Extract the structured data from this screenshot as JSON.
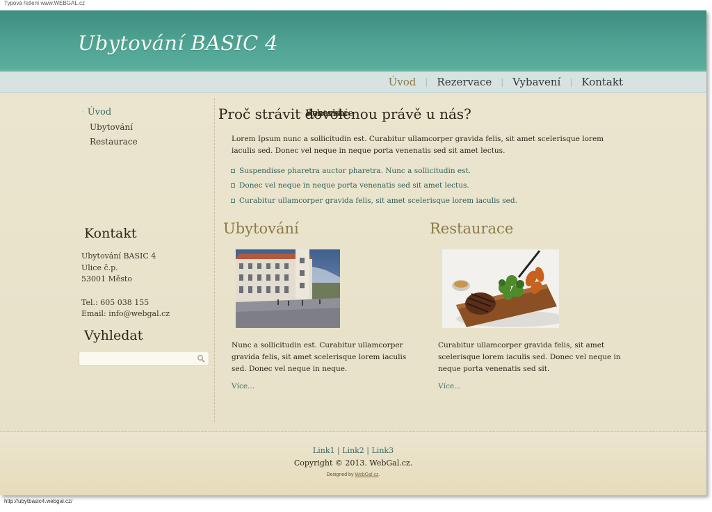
{
  "top_note": "Typová řešení www.WEBGAL.cz",
  "site_title": "Ubytování BASIC 4",
  "top_nav": {
    "items": [
      "Úvod",
      "Rezervace",
      "Vybavení",
      "Kontakt"
    ],
    "active": "Úvod"
  },
  "sidebar": {
    "menu": {
      "uvod": "Úvod",
      "ubytovani": "Ubytování",
      "restaurace": "Restaurace",
      "rezervace": "Rezervace",
      "vybaveni": "Vybavení",
      "kontakt": "Kontakt"
    },
    "contact_heading": "Kontakt",
    "contact_lines": {
      "name": "Ubytování BASIC 4",
      "street": "Ulice č.p.",
      "city": "53001 Město",
      "phone": "Tel.: 605 038 155",
      "email": "Email: info@webgal.cz"
    },
    "search_heading": "Vyhledat",
    "search_value": "",
    "search_icon": "magnifier-icon"
  },
  "main": {
    "heading": "Proč strávit dovolenou právě u nás?",
    "lead": "Lorem Ipsum nunc a sollicitudin est. Curabitur ullamcorper gravida felis, sit amet scelerisque lorem iaculis sed. Donec vel neque in neque porta venenatis sed sit amet lectus.",
    "bullets": [
      "Suspendisse pharetra auctor pharetra. Nunc a sollicitudin est.",
      "Donec vel neque in neque porta venenatis sed sit amet lectus.",
      "Curabitur ullamcorper gravida felis, sit amet scelerisque lorem iaculis sed."
    ],
    "col1": {
      "title": "Ubytování",
      "text": "Nunc a sollicitudin est. Curabitur ullamcorper gravida felis, sit amet scelerisque lorem iaculis sed. Donec vel neque in neque.",
      "more": "Více..."
    },
    "col2": {
      "title": "Restaurace",
      "text": "Curabitur ullamcorper gravida felis, sit amet scelerisque lorem iaculis sed. Donec vel neque in neque porta venenatis sed sit.",
      "more": "Více..."
    }
  },
  "footer": {
    "link1": "Link1",
    "link2": "Link2",
    "link3": "Link3",
    "sep": "|",
    "copyright": "Copyright © 2013. WebGal.cz.",
    "designed_prefix": "Designed by ",
    "designed_link": "WebGal.cz",
    "designed_suffix": "."
  },
  "status_url": "http://ubytbasic4.webgal.cz/",
  "colors": {
    "header": "#4fa393",
    "navbar": "#d6e3e0",
    "background": "#ebe5cf",
    "accent_olive": "#8a7a48",
    "link_teal": "#3d6b63"
  }
}
